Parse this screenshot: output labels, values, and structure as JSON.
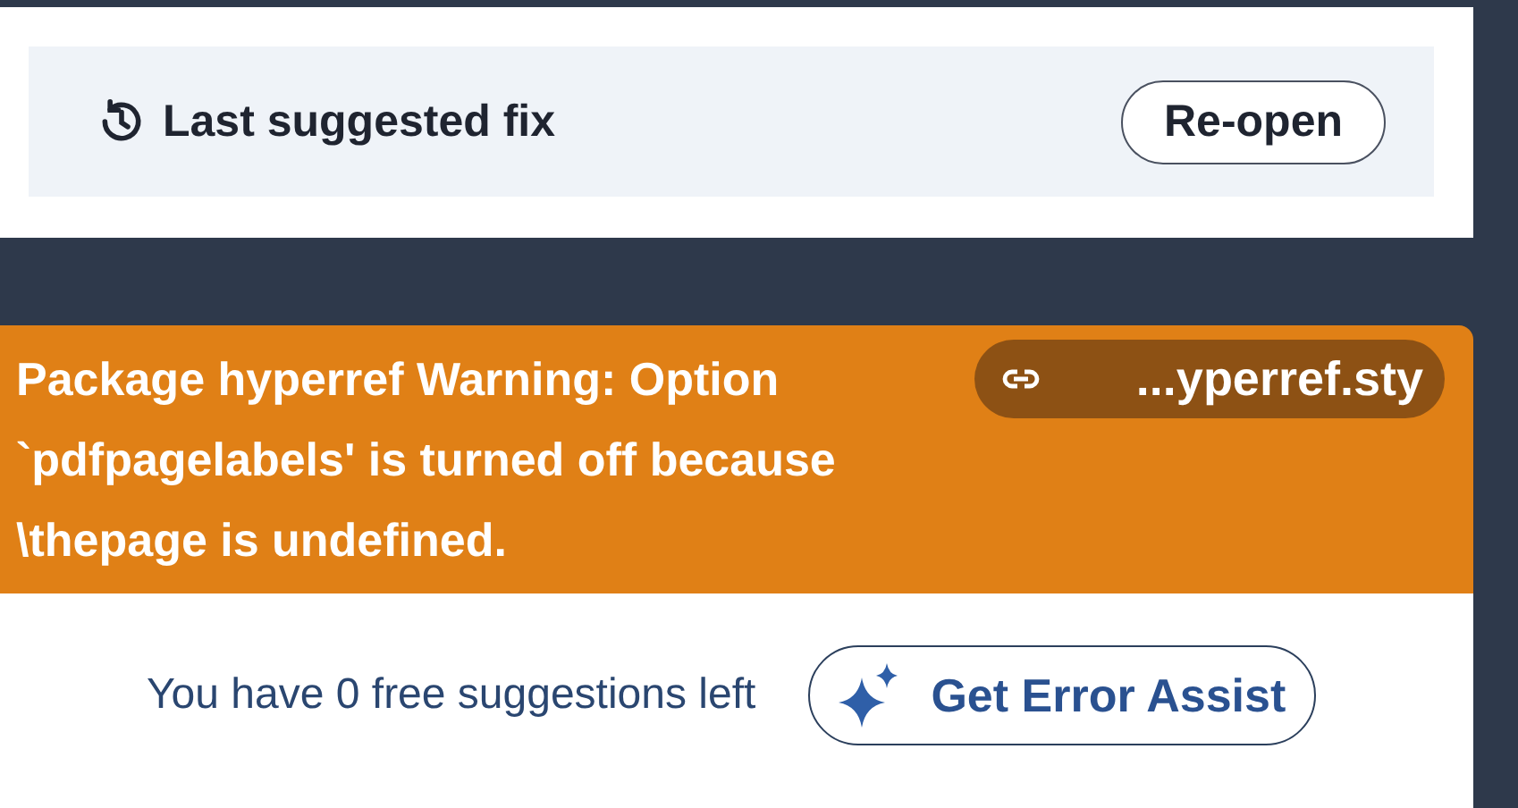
{
  "last_fix": {
    "title": "Last suggested fix",
    "button": "Re-open"
  },
  "error": {
    "message": "Package hyperref Warning: Option `pdfpagelabels' is turned off because \\thepage is undefined.",
    "file": "...yperref.sty"
  },
  "assist": {
    "text": "You have 0 free suggestions left",
    "button": "Get Error Assist"
  }
}
